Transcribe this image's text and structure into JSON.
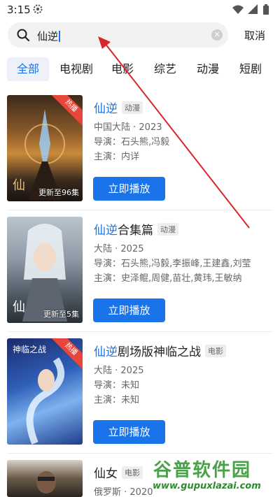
{
  "status_bar": {
    "time": "3:15"
  },
  "search": {
    "query": "仙逆",
    "cancel_label": "取消"
  },
  "tabs": [
    {
      "label": "全部"
    },
    {
      "label": "电视剧"
    },
    {
      "label": "电影"
    },
    {
      "label": "综艺"
    },
    {
      "label": "动漫"
    },
    {
      "label": "短剧"
    }
  ],
  "results": [
    {
      "title_highlight": "仙逆",
      "title_rest": "",
      "tag": "动漫",
      "region_year": "中国大陆 · 2023",
      "director": "导演：石头熊,冯毅",
      "cast": "主演：内详",
      "poster_caption": "更新至96集",
      "badge": "热播",
      "play_label": "立即播放"
    },
    {
      "title_highlight": "仙逆",
      "title_rest": "合集篇",
      "tag": "动漫",
      "region_year": "大陆 · 2025",
      "director": "导演：石头熊,冯毅,李振峰,王建鑫,刘莹",
      "cast": "主演：史泽鲲,周健,苗壮,黄玮,王敏纳",
      "poster_caption": "更新至5集",
      "badge": "",
      "play_label": "立即播放"
    },
    {
      "title_highlight": "仙逆",
      "title_rest": "剧场版神临之战",
      "tag": "电影",
      "region_year": "大陆 · 2025",
      "director": "导演：未知",
      "cast": "主演：未知",
      "poster_caption": "",
      "badge": "热播",
      "play_label": "立即播放"
    },
    {
      "title_highlight": "",
      "title_rest": "仙女",
      "tag": "电影",
      "region_year": "俄罗斯 · 2020",
      "director": "",
      "cast": "",
      "poster_caption": "",
      "badge": "",
      "play_label": ""
    }
  ],
  "watermark": {
    "text": "谷普软件园",
    "url": "www.gupuxlazai.com"
  },
  "colors": {
    "accent": "#1a73e8",
    "hot_badge": "#e9463b",
    "arrow": "#d9262c",
    "tab_active_bg": "#eef2f8"
  }
}
